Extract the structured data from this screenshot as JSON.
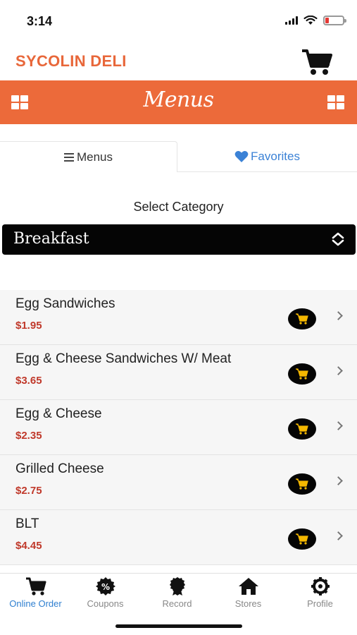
{
  "status_bar": {
    "time": "3:14"
  },
  "header": {
    "brand": "SYCOLIN DELI",
    "cart_icon": "cart-icon"
  },
  "menu_bar": {
    "title": "Menus",
    "left_icon": "grid-icon",
    "right_icon": "grid-icon",
    "accent": "#ec6a3a"
  },
  "tabs": [
    {
      "label": "Menus",
      "icon": "hamburger-icon",
      "active": true
    },
    {
      "label": "Favorites",
      "icon": "heart-icon",
      "active": false,
      "color": "#3b82d6"
    }
  ],
  "category": {
    "label": "Select Category",
    "selected": "Breakfast"
  },
  "items": [
    {
      "name": "Egg Sandwiches",
      "price": "$1.95"
    },
    {
      "name": "Egg & Cheese Sandwiches W/ Meat",
      "price": "$3.65"
    },
    {
      "name": "Egg & Cheese",
      "price": "$2.35"
    },
    {
      "name": "Grilled Cheese",
      "price": "$2.75"
    },
    {
      "name": "BLT",
      "price": "$4.45"
    }
  ],
  "tabbar": [
    {
      "label": "Online Order",
      "icon": "cart-icon",
      "active": true
    },
    {
      "label": "Coupons",
      "icon": "coupon-icon",
      "active": false
    },
    {
      "label": "Record",
      "icon": "badge-icon",
      "active": false
    },
    {
      "label": "Stores",
      "icon": "home-icon",
      "active": false
    },
    {
      "label": "Profile",
      "icon": "gear-icon",
      "active": false
    }
  ],
  "colors": {
    "price": "#c0392b",
    "brand": "#e8673a",
    "cart_button": "#f5b800",
    "active_tab": "#2f7fd0"
  }
}
